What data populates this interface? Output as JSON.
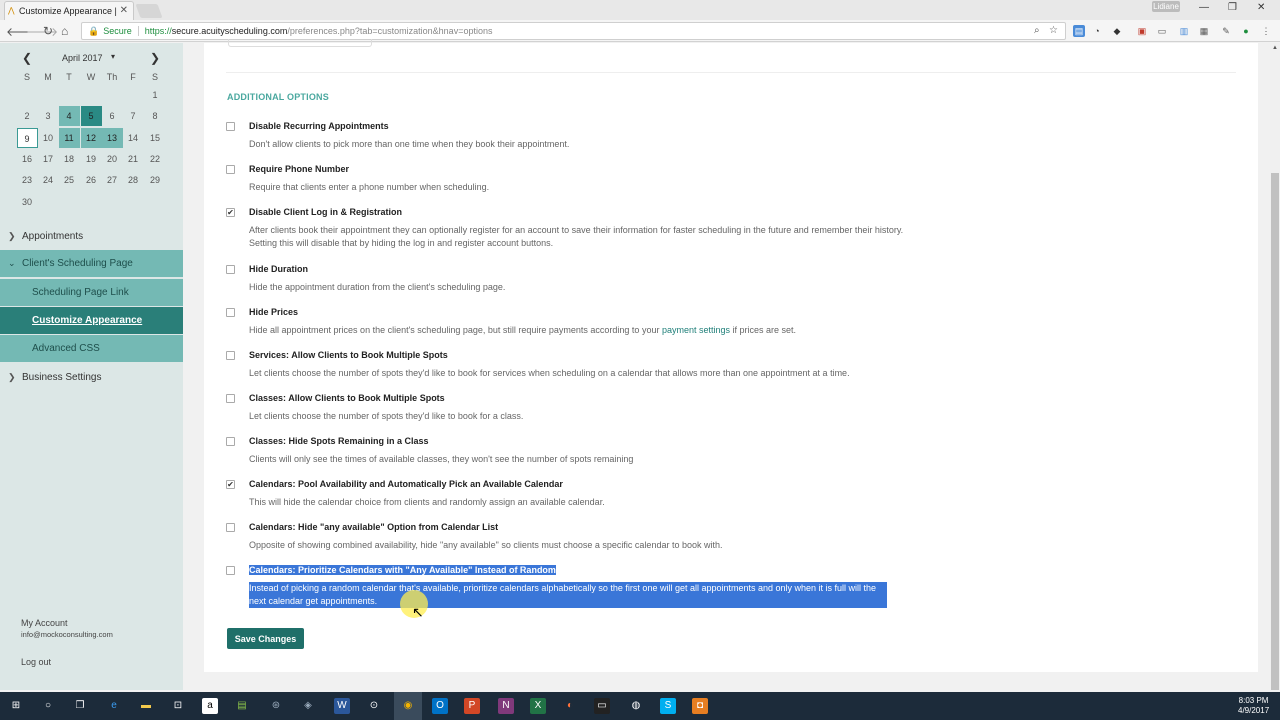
{
  "browser": {
    "tab_title": "Customize Appearance |",
    "tab_close": "✕",
    "favicon": "⋀",
    "user_badge": "Lidiane",
    "window_buttons": [
      "—",
      "❐",
      "✕"
    ],
    "omnibox": {
      "secure_label": "Secure",
      "url_protocol": "https://",
      "url_host": "secure.acuityscheduling.com",
      "url_path": "/preferences.php?tab=customization&hnav=options"
    }
  },
  "calendar": {
    "month_label": "April 2017",
    "prev": "❮",
    "next": "❯",
    "caret": "▾",
    "weekdays": [
      "S",
      "M",
      "T",
      "W",
      "Th",
      "F",
      "S"
    ],
    "weeks": [
      [
        "",
        "",
        "",
        "",
        "",
        "",
        "1"
      ],
      [
        "2",
        "3",
        "4",
        "5",
        "6",
        "7",
        "8"
      ],
      [
        "9",
        "10",
        "11",
        "12",
        "13",
        "14",
        "15"
      ],
      [
        "16",
        "17",
        "18",
        "19",
        "20",
        "21",
        "22"
      ],
      [
        "23",
        "24",
        "25",
        "26",
        "27",
        "28",
        "29"
      ],
      [
        "30",
        "",
        "",
        "",
        "",
        "",
        ""
      ]
    ],
    "today": "9",
    "selected": "5",
    "highlighted_week_days": [
      "4",
      "5",
      "11",
      "12",
      "13"
    ]
  },
  "sidebar": {
    "appointments": "Appointments",
    "clients_page": "Client's Scheduling Page",
    "sub_items": [
      "Scheduling Page Link",
      "Customize Appearance",
      "Advanced CSS"
    ],
    "active_sub": "Customize Appearance",
    "business_settings": "Business Settings",
    "my_account": "My Account",
    "email": "info@mockoconsulting.com",
    "logout": "Log out"
  },
  "content": {
    "section_title": "ADDITIONAL OPTIONS",
    "options": [
      {
        "title": "Disable Recurring Appointments",
        "desc": "Don't allow clients to pick more than one time when they book their appointment.",
        "checked": false
      },
      {
        "title": "Require Phone Number",
        "desc": "Require that clients enter a phone number when scheduling.",
        "checked": false
      },
      {
        "title": "Disable Client Log in & Registration",
        "desc": "After clients book their appointment they can optionally register for an account to save their information for faster scheduling in the future and remember their history. Setting this will disable that by hiding the log in and register account buttons.",
        "checked": true
      },
      {
        "title": "Hide Duration",
        "desc": "Hide the appointment duration from the client's scheduling page.",
        "checked": false
      },
      {
        "title": "Hide Prices",
        "desc_before": "Hide all appointment prices on the client's scheduling page, but still require payments according to your ",
        "desc_link": "payment settings",
        "desc_after": " if prices are set.",
        "checked": false
      },
      {
        "title": "Services: Allow Clients to Book Multiple Spots",
        "desc": "Let clients choose the number of spots they'd like to book for services when scheduling on a calendar that allows more than one appointment at a time.",
        "checked": false
      },
      {
        "title": "Classes: Allow Clients to Book Multiple Spots",
        "desc": "Let clients choose the number of spots they'd like to book for a class.",
        "checked": false
      },
      {
        "title": "Classes: Hide Spots Remaining in a Class",
        "desc": "Clients will only see the times of available classes, they won't see the number of spots remaining",
        "checked": false
      },
      {
        "title": "Calendars: Pool Availability and Automatically Pick an Available Calendar",
        "desc": "This will hide the calendar choice from clients and randomly assign an available calendar.",
        "checked": true
      },
      {
        "title": "Calendars: Hide \"any available\" Option from Calendar List",
        "desc": "Opposite of showing combined availability, hide \"any available\" so clients must choose a specific calendar to book with.",
        "checked": false
      },
      {
        "title": "Calendars: Prioritize Calendars with \"Any Available\" Instead of Random",
        "desc": "Instead of picking a random calendar that's available, prioritize calendars alphabetically so the first one will get all appointments and only when it is full will the next calendar get appointments.",
        "checked": false,
        "selected": true
      }
    ],
    "save_button": "Save Changes"
  },
  "taskbar": {
    "time": "8:03 PM",
    "date": "4/9/2017"
  },
  "colors": {
    "accent": "#4aa89f",
    "sidebar_bg": "#dce7e6",
    "nav_open": "#74b9b4",
    "nav_active": "#2a7f79",
    "save_button": "#1f6f69",
    "selection": "#3a76d8"
  }
}
